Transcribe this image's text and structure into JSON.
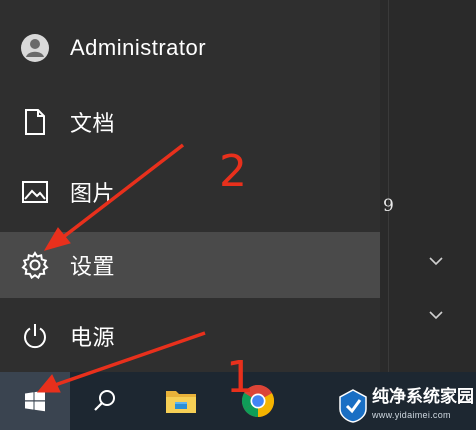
{
  "start_menu": {
    "items": [
      {
        "label": "Administrator",
        "icon": "user-avatar-icon"
      },
      {
        "label": "文档",
        "icon": "document-icon"
      },
      {
        "label": "图片",
        "icon": "picture-icon"
      },
      {
        "label": "设置",
        "icon": "gear-icon"
      },
      {
        "label": "电源",
        "icon": "power-icon"
      }
    ]
  },
  "tiles": {
    "number": "9"
  },
  "taskbar": {
    "items": [
      {
        "icon": "windows-start-icon"
      },
      {
        "icon": "search-icon"
      },
      {
        "icon": "file-explorer-icon"
      },
      {
        "icon": "chrome-icon"
      }
    ]
  },
  "annotations": {
    "step1": "1",
    "step2": "2",
    "color": "#e8301c"
  },
  "watermark": {
    "text": "纯净系统家园",
    "url": "www.yidaimei.com"
  },
  "colors": {
    "menu_bg": "#2f2f2f",
    "highlight_bg": "#4a4a4a",
    "taskbar_bg": "#1d2731"
  }
}
